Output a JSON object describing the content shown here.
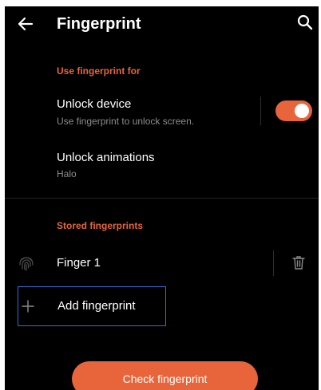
{
  "app_bar": {
    "title": "Fingerprint",
    "back_icon": "arrow-left-icon",
    "search_icon": "search-icon"
  },
  "section_use": {
    "header": "Use fingerprint for",
    "unlock_device": {
      "title": "Unlock device",
      "subtitle": "Use fingerprint to unlock screen.",
      "toggle_on": true
    },
    "unlock_animations": {
      "title": "Unlock animations",
      "subtitle": "Halo"
    }
  },
  "section_stored": {
    "header": "Stored fingerprints",
    "fingerprints": [
      {
        "name": "Finger 1",
        "icon": "fingerprint-icon",
        "action_icon": "trash-icon"
      }
    ],
    "add_label": "Add fingerprint",
    "add_icon": "plus-icon"
  },
  "check_button": {
    "label": "Check fingerprint"
  },
  "colors": {
    "accent": "#e8643a",
    "background": "#000000",
    "text_primary": "#ffffff",
    "text_secondary": "#8c8c8c",
    "focus_outline": "#2d6fd6"
  }
}
